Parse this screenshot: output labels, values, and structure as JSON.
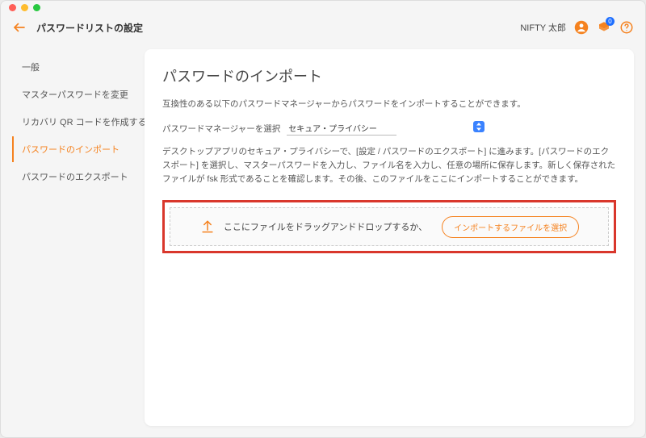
{
  "header": {
    "title": "パスワードリストの設定",
    "user_name": "NIFTY 太郎",
    "notif_badge": "0"
  },
  "sidebar": {
    "items": [
      {
        "label": "一般"
      },
      {
        "label": "マスターパスワードを変更"
      },
      {
        "label": "リカバリ QR コードを作成する"
      },
      {
        "label": "パスワードのインポート"
      },
      {
        "label": "パスワードのエクスポート"
      }
    ]
  },
  "main": {
    "title": "パスワードのインポート",
    "subtitle": "互換性のある以下のパスワードマネージャーからパスワードをインポートすることができます。",
    "select_label": "パスワードマネージャーを選択",
    "select_value": "セキュア・プライバシー",
    "description": "デスクトップアプリのセキュア・プライバシーで、[設定 / パスワードのエクスポート] に進みます。[パスワードのエクスポート] を選択し、マスターパスワードを入力し、ファイル名を入力し、任意の場所に保存します。新しく保存されたファイルが fsk 形式であることを確認します。その後、このファイルをここにインポートすることができます。",
    "dropzone_text": "ここにファイルをドラッグアンドドロップするか、",
    "dropzone_button": "インポートするファイルを選択"
  }
}
